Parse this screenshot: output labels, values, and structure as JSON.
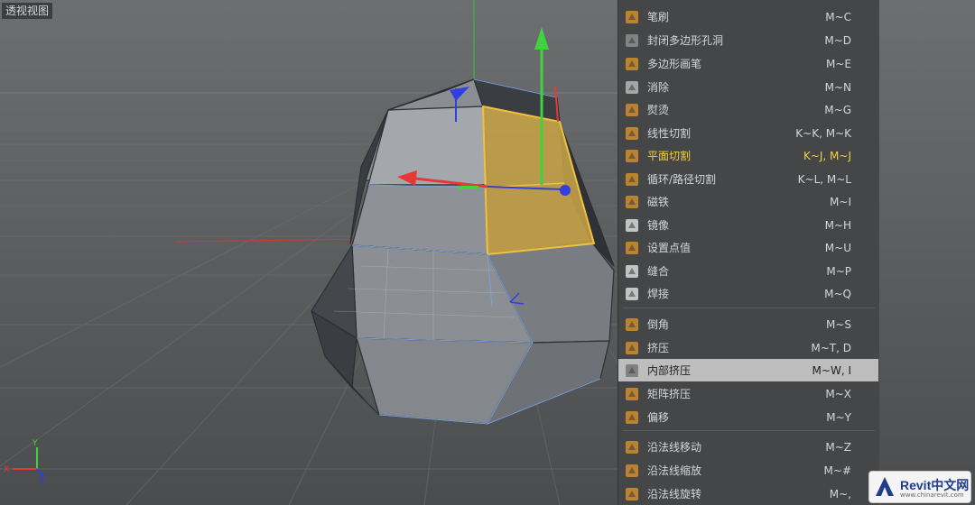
{
  "viewport": {
    "label": "透视视图",
    "axis_labels": {
      "x": "X",
      "y": "Y",
      "z": "Z"
    }
  },
  "menu": {
    "items": [
      {
        "label": "笔刷",
        "shortcut": "M~C",
        "icon": "brush-icon"
      },
      {
        "label": "封闭多边形孔洞",
        "shortcut": "M~D",
        "icon": "close-hole-icon"
      },
      {
        "label": "多边形画笔",
        "shortcut": "M~E",
        "icon": "polygon-pen-icon"
      },
      {
        "label": "消除",
        "shortcut": "M~N",
        "icon": "dissolve-icon"
      },
      {
        "label": "熨烫",
        "shortcut": "M~G",
        "icon": "iron-icon"
      },
      {
        "label": "线性切割",
        "shortcut": "K~K, M~K",
        "icon": "line-cut-icon"
      },
      {
        "label": "平面切割",
        "shortcut": "K~J, M~J",
        "icon": "plane-cut-icon",
        "state": "active"
      },
      {
        "label": "循环/路径切割",
        "shortcut": "K~L, M~L",
        "icon": "loop-cut-icon"
      },
      {
        "label": "磁铁",
        "shortcut": "M~I",
        "icon": "magnet-icon"
      },
      {
        "label": "镜像",
        "shortcut": "M~H",
        "icon": "mirror-icon"
      },
      {
        "label": "设置点值",
        "shortcut": "M~U",
        "icon": "set-point-icon"
      },
      {
        "label": "缝合",
        "shortcut": "M~P",
        "icon": "stitch-icon"
      },
      {
        "label": "焊接",
        "shortcut": "M~Q",
        "icon": "weld-icon"
      },
      {
        "label": "倒角",
        "shortcut": "M~S",
        "icon": "bevel-icon"
      },
      {
        "label": "挤压",
        "shortcut": "M~T, D",
        "icon": "extrude-icon"
      },
      {
        "label": "内部挤压",
        "shortcut": "M~W, I",
        "icon": "extrude-inner-icon",
        "state": "highlighted"
      },
      {
        "label": "矩阵挤压",
        "shortcut": "M~X",
        "icon": "matrix-extrude-icon"
      },
      {
        "label": "偏移",
        "shortcut": "M~Y",
        "icon": "offset-icon"
      },
      {
        "label": "沿法线移动",
        "shortcut": "M~Z",
        "icon": "normal-move-icon"
      },
      {
        "label": "沿法线缩放",
        "shortcut": "M~#",
        "icon": "normal-scale-icon"
      },
      {
        "label": "沿法线旋转",
        "shortcut": "M~,",
        "icon": "normal-rotate-icon"
      }
    ]
  },
  "watermark": {
    "brand": "Revit中文网",
    "url": "www.chinarevit.com"
  },
  "colors": {
    "x_axis": "#e53935",
    "y_axis": "#3fd43f",
    "z_axis": "#2f3fe0",
    "selection": "#d8a63a",
    "active_text": "#f4d03f",
    "highlight_row": "#bdbdbd"
  }
}
